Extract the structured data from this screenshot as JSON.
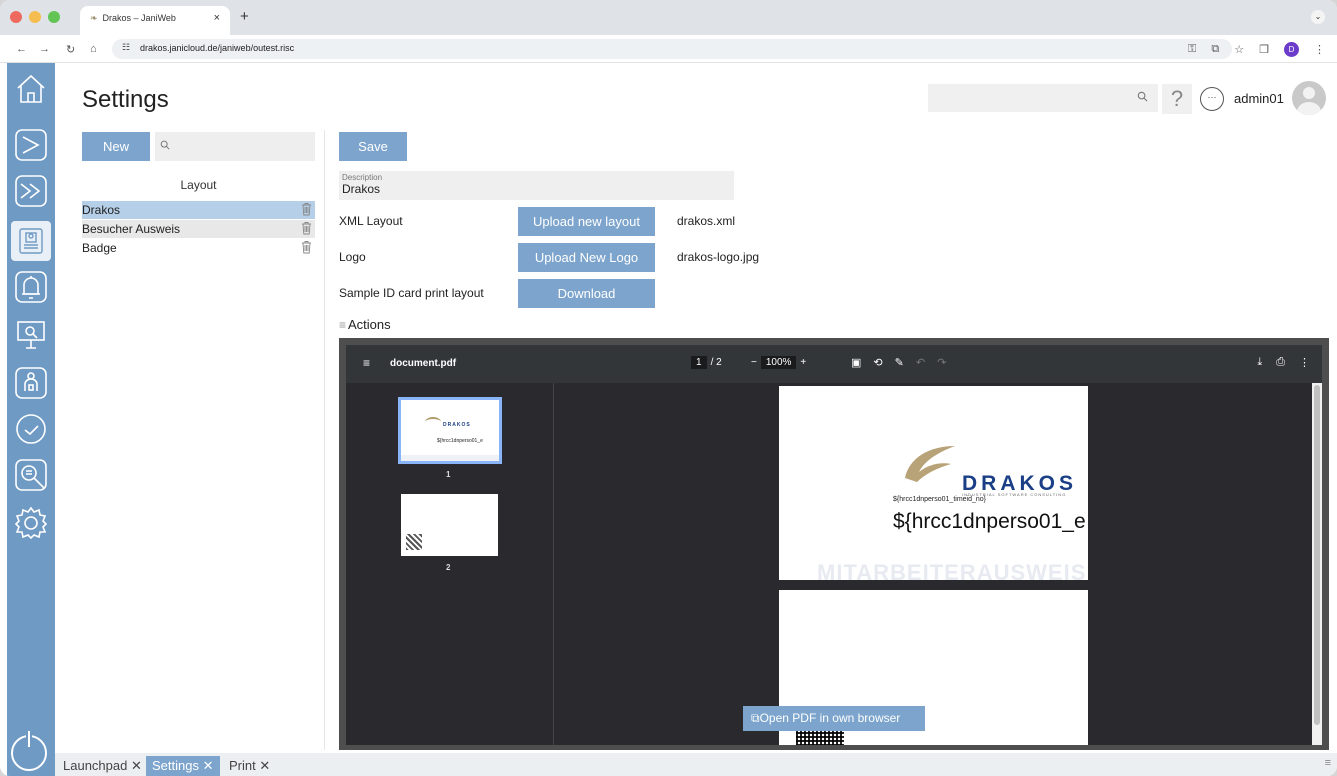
{
  "browser": {
    "tab_title": "Drakos – JaniWeb",
    "tab_close": "×",
    "new_tab": "+",
    "url": "drakos.janicloud.de/janiweb/outest.risc",
    "profile_initial": "D",
    "traffic_colors": [
      "#ee6a5f",
      "#f5bd4f",
      "#61c454"
    ]
  },
  "header": {
    "title": "Settings",
    "user_name": "admin01",
    "search_icon": "search-icon",
    "help_icon": "?"
  },
  "left_panel": {
    "new_label": "New",
    "list_header": "Layout",
    "items": [
      {
        "label": "Drakos",
        "selected": true
      },
      {
        "label": "Besucher Ausweis",
        "selected": false
      },
      {
        "label": "Badge",
        "selected": false
      }
    ]
  },
  "form": {
    "save_label": "Save",
    "description_label": "Description",
    "description_value": "Drakos",
    "xml_layout_label": "XML Layout",
    "upload_layout_label": "Upload new layout",
    "xml_file": "drakos.xml",
    "logo_label": "Logo",
    "upload_logo_label": "Upload New Logo",
    "logo_file": "drakos-logo.jpg",
    "sample_label": "Sample ID card print layout",
    "download_label": "Download",
    "actions_label": "Actions"
  },
  "pdf": {
    "file_name": "document.pdf",
    "current_page": "1",
    "page_sep": "/",
    "total_pages": "2",
    "zoom_minus": "−",
    "zoom": "100%",
    "zoom_plus": "+",
    "thumb1_num": "1",
    "thumb2_num": "2",
    "brand": "DRAKOS",
    "brand_sub": "INDUSTRIAL SOFTWARE CONSULTING",
    "placeholder_small": "${hrcc1dnperso01_timeid_no}",
    "placeholder_large": "${hrcc1dnperso01_e",
    "watermark": "MITARBEITERAUSWEIS",
    "thumb_placeholder": "${hrcc1dnperso01_e",
    "thumb_brand": "DRAKOS",
    "open_in_browser": "Open PDF in own browser"
  },
  "bottom_tabs": [
    {
      "label": "Launchpad",
      "active": false
    },
    {
      "label": "Settings",
      "active": true
    },
    {
      "label": "Print",
      "active": false
    }
  ],
  "colors": {
    "sidebar": "#6f9ac4",
    "button": "#7ca4cc",
    "selected_row": "#b5cfe8",
    "pdf_toolbar": "#323639"
  }
}
